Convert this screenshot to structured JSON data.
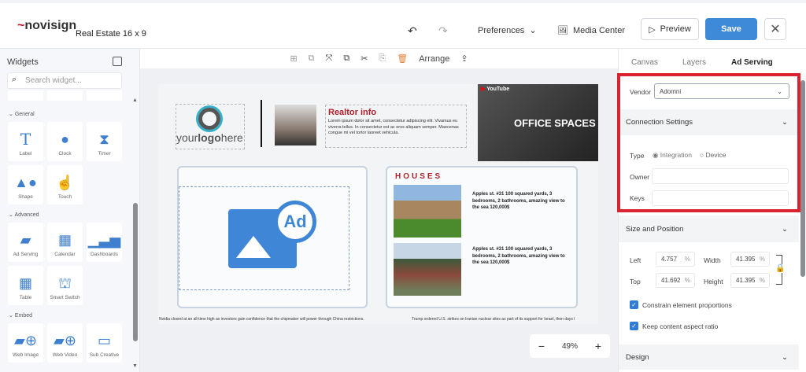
{
  "header": {
    "logo_text": "novisign",
    "title": "Real Estate 16 x 9",
    "preferences": "Preferences",
    "media_center": "Media Center",
    "preview": "Preview",
    "save": "Save"
  },
  "sidebar": {
    "title": "Widgets",
    "search_placeholder": "Search widget...",
    "sections": [
      {
        "name": "General",
        "items": [
          "Label",
          "Clock",
          "Timer",
          "Shape",
          "Touch"
        ]
      },
      {
        "name": "Advanced",
        "items": [
          "Ad Serving",
          "Calendar",
          "Dashboards",
          "Table",
          "Smart Switch"
        ]
      },
      {
        "name": "Embed",
        "items": [
          "Web Image",
          "Web Video",
          "Sub Creative"
        ]
      }
    ]
  },
  "toolbar": {
    "arrange": "Arrange"
  },
  "slide": {
    "logo_pre": "your",
    "logo_bold": "logo",
    "logo_post": "here",
    "realtor_title": "Realtor info",
    "realtor_text": "Lorem ipsum dolor sit amet, consectetur adipiscing elit. Vivamus eu viverra tellus. In consectetur est ac eros aliquam semper. Maecenas congue mi vel tortor laoreet vehicula.",
    "youtube": "YouTube",
    "video_caption": "OFFICE SPACES",
    "ad_text": "Ad",
    "houses_title": "HOUSES",
    "listings": [
      {
        "text": "Apples st. #31 100 squared yards, 3 bedrooms, 2 bathrooms, amazing view to the sea 120,000$"
      },
      {
        "text": "Apples st. #31 100 squared yards, 3 bedrooms, 2 bathrooms, amazing view to the sea 120,000$"
      }
    ],
    "ticker": [
      "Nvidia closed at an all-time high as investors gain confidence that the chipmaker will power through China restrictions.",
      "Trump ordered U.S. strikes on Iranian nuclear sites as part of its support for Israel, then days l"
    ]
  },
  "zoom": {
    "value": "49%",
    "minus": "−",
    "plus": "+"
  },
  "panel": {
    "tabs": [
      "Canvas",
      "Layers",
      "Ad Serving"
    ],
    "active_tab": "Ad Serving",
    "vendor_label": "Vendor",
    "vendor_value": "Adomni",
    "connection_settings": "Connection Settings",
    "type_label": "Type",
    "type_options": [
      "Integration",
      "Device"
    ],
    "owner_label": "Owner",
    "owner_value": "",
    "keys_label": "Keys",
    "keys_value": "",
    "size_position": "Size and Position",
    "left_label": "Left",
    "left_value": "4.757",
    "top_label": "Top",
    "top_value": "41.692",
    "width_label": "Width",
    "width_value": "41.395",
    "height_label": "Height",
    "height_value": "41.395",
    "unit": "%",
    "constrain": "Constrain element proportions",
    "keep_aspect": "Keep content aspect ratio",
    "design": "Design"
  },
  "colors": {
    "accent": "#3f8ad8",
    "highlight": "#d9232e",
    "brand_red": "#c8102e"
  }
}
